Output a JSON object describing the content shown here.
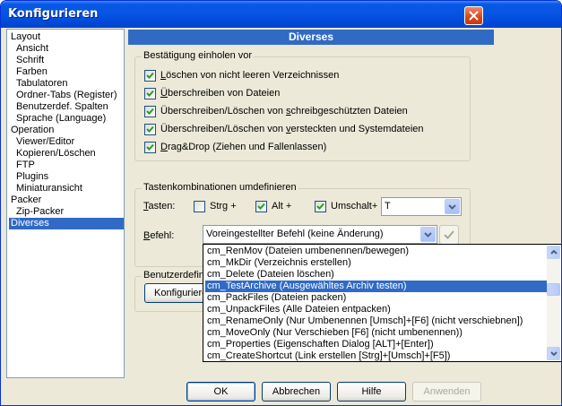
{
  "window": {
    "title": "Konfigurieren"
  },
  "tree": {
    "items": [
      {
        "label": "Layout",
        "indent": 0
      },
      {
        "label": "Ansicht",
        "indent": 1
      },
      {
        "label": "Schrift",
        "indent": 1
      },
      {
        "label": "Farben",
        "indent": 1
      },
      {
        "label": "Tabulatoren",
        "indent": 1
      },
      {
        "label": "Ordner-Tabs (Register)",
        "indent": 1
      },
      {
        "label": "Benutzerdef. Spalten",
        "indent": 1
      },
      {
        "label": "Sprache (Language)",
        "indent": 1
      },
      {
        "label": "Operation",
        "indent": 0
      },
      {
        "label": "Viewer/Editor",
        "indent": 1
      },
      {
        "label": "Kopieren/Löschen",
        "indent": 1
      },
      {
        "label": "FTP",
        "indent": 1
      },
      {
        "label": "Plugins",
        "indent": 1
      },
      {
        "label": "Miniaturansicht",
        "indent": 1
      },
      {
        "label": "Packer",
        "indent": 0
      },
      {
        "label": "Zip-Packer",
        "indent": 1
      },
      {
        "label": "Diverses",
        "indent": 0,
        "selected": true
      }
    ]
  },
  "panel": {
    "title": "Diverses"
  },
  "confirm": {
    "legend": "Bestätigung einholen vor",
    "items": [
      {
        "pre": "",
        "u": "L",
        "post": "öschen von nicht leeren Verzeichnissen",
        "checked": true
      },
      {
        "pre": "",
        "u": "Ü",
        "post": "berschreiben von Dateien",
        "checked": true
      },
      {
        "pre": "Überschreiben/Löschen von ",
        "u": "s",
        "post": "chreibgeschützten Dateien",
        "checked": true
      },
      {
        "pre": "Überschreiben/Löschen von ",
        "u": "v",
        "post": "ersteckten und Systemdateien",
        "checked": true
      },
      {
        "pre": "",
        "u": "D",
        "post": "rag&Drop (Ziehen und Fallenlassen)",
        "checked": true
      }
    ]
  },
  "keys": {
    "legend": "Tastenkombinationen umdefinieren",
    "tasten_pre": "",
    "tasten_u": "T",
    "tasten_post": "asten:",
    "ctrl": {
      "label": "Strg +",
      "checked": false
    },
    "alt": {
      "label": "Alt +",
      "checked": true
    },
    "shift": {
      "label": "Umschalt+",
      "checked": true
    },
    "key_value": "T",
    "befehl_pre": "",
    "befehl_u": "B",
    "befehl_post": "efehl:",
    "befehl_value": "Voreingestellter Befehl (keine Änderung)"
  },
  "userdef": {
    "legend_partial": "Benutzerdefini",
    "button_partial": "Konfigurieren"
  },
  "dropdown": {
    "items": [
      "cm_RenMov (Dateien umbenennen/bewegen)",
      "cm_MkDir (Verzeichnis erstellen)",
      "cm_Delete (Dateien löschen)",
      "cm_TestArchive (Ausgewähltes Archiv testen)",
      "cm_PackFiles (Dateien packen)",
      "cm_UnpackFiles (Alle Dateien entpacken)",
      "cm_RenameOnly (Nur Umbenennen [Umsch]+[F6] (nicht verschiebnen])",
      "cm_MoveOnly (Nur Verschieben  [F6]  (nicht umbenennen))",
      "cm_Properties (Eigenschaften Dialog  [ALT]+[Enter])",
      "cm_CreateShortcut (Link erstellen  [Strg]+[Umsch]+[F5])"
    ],
    "selected_index": 3
  },
  "buttons": {
    "ok": "OK",
    "cancel": "Abbrechen",
    "help": "Hilfe",
    "apply": "Anwenden"
  },
  "icons": {
    "close": "close-x-icon",
    "dropdown": "chevron-down-icon",
    "checkmark": "checkmark-icon",
    "scroll_up": "arrow-up-icon",
    "scroll_down": "arrow-down-icon"
  }
}
